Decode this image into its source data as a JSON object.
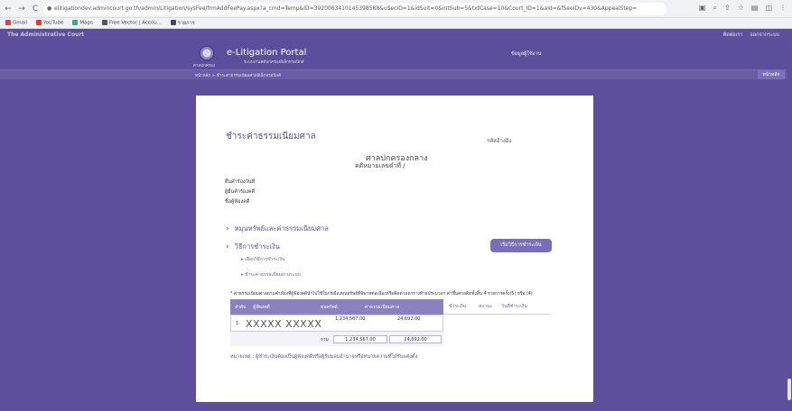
{
  "browser": {
    "url": "elitigationdev.admincourt.go.th/admin/Litigation/sysFee/frmAddFeePay.aspx?a_cmd=Temp&ID=3920063410145398588&uSecID=1&idSuit=0&intSub=5&txtCase=10&Court_ID=1&aId=&fSeeIDv=430&AppealStep=",
    "bookmarks": [
      "Gmail",
      "YouTube",
      "Maps",
      "Free Vector | Accou...",
      "รายการ"
    ]
  },
  "app_strip": {
    "title": "The Administrative Court",
    "right_items": [
      "ติดต่อเรา",
      "ออกจากระบบ"
    ]
  },
  "portal": {
    "logo_caption": "ศาลปกครอง",
    "name": "e-Litigation Portal",
    "subtitle": "ระบบงานคดีปกครองอิเล็กทรอนิกส์",
    "right_text": "ข้อมูลผู้ใช้งาน"
  },
  "breadcrumb": "หน้าหลัก > ชำระค่าธรรมเนียมศาลอิเล็กทรอนิกส์",
  "home_button": "หน้าหลัก",
  "main": {
    "heading": "ชำระค่าธรรมเนียมศาล",
    "ref_label": "รหัสอ้างอิง",
    "court_name": "ศาลปกครองกลาง",
    "case_number": "คดีหมายเลขดำที่   /",
    "info": [
      "ยื่นคำร้องวันที่",
      "ผู้ยื่นคำร้องคดี",
      "ชื่อผู้ฟ้องคดี"
    ],
    "section_calc": "หมุนหรัพย์และค่าธรรมเนียมศาล",
    "section_payment": "วิธีการชำระเงิน",
    "payment_links": [
      "เลือกวิธีการชำระเงิน",
      "ชำระค่าธรรมเนียมผ่านระบบ"
    ],
    "pay_button": "เริ่มวิธีการชำระเงิน",
    "note": "* ค่าธรรมเนียมศาลตามคำฟ้องที่ผู้ฟ้องคดีนำไปใช้ในกรณีลงทุนทรัพย์ที่พิพาทต่อเนื่องหรือคิดตามตารางท้ายประมวลฯ ค่าขึ้นศาลคิดทั้งสิ้น 4 รายการครั้ง(5) หรือ (4)"
  },
  "table": {
    "headers": [
      "ลำดับ",
      "ผู้ฟ้องคดี",
      "ทุนทรัพย์",
      "ค่าธรรมเนียมศาล",
      "ชำระเงิน",
      "สถานะ",
      "วันที่ชำระเงิน"
    ],
    "rows": [
      {
        "no": "1.",
        "name": "XXXXX   XXXXX",
        "capital": "1,234,567.00",
        "fee": "24,692.00"
      }
    ],
    "total_label": "รวม",
    "total_capital": "1,234,567.00",
    "total_fee": "24,692.00"
  },
  "remark": "หมายเหตุ : ผู้ชำระเงินต้องเป็นผู้ฟ้องคดีหรือผู้รับมอบอำนาจหรือทนายความที่ได้รับแต่งตั้ง"
}
